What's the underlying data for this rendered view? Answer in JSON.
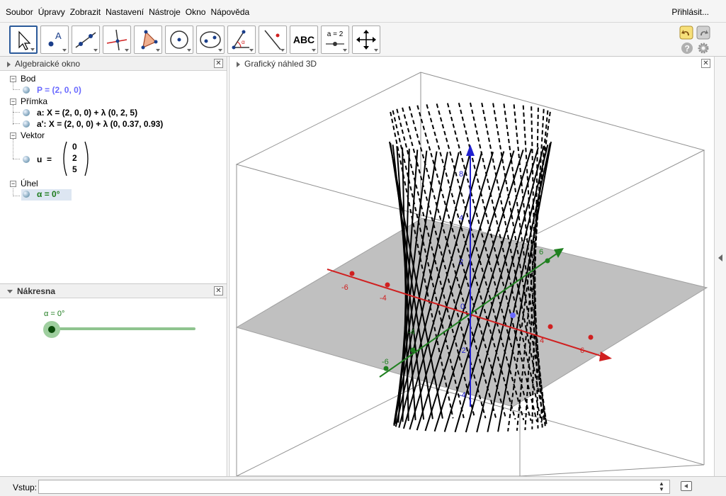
{
  "menu": {
    "items": [
      "Soubor",
      "Úpravy",
      "Zobrazit",
      "Nastavení",
      "Nástroje",
      "Okno",
      "Nápověda"
    ],
    "login": "Přihlásit..."
  },
  "toolbar": {
    "tools": [
      "move-tool",
      "point-tool",
      "line-tool",
      "perpendicular-tool",
      "polygon-tool",
      "circle-tool",
      "ellipse-tool",
      "angle-tool",
      "reflect-tool",
      "text-tool",
      "slider-tool",
      "move-view-tool"
    ],
    "text_tool_label": "ABC",
    "slider_tool_label": "a = 2"
  },
  "algebra": {
    "title": "Algebraické okno",
    "categories": [
      {
        "name": "Bod",
        "items": [
          "P = (2, 0, 0)"
        ]
      },
      {
        "name": "Přímka",
        "items": [
          "a: X = (2, 0, 0) + λ (0, 2, 5)",
          "a': X = (2, 0, 0) + λ (0, 0.37, 0.93)"
        ]
      },
      {
        "name": "Vektor",
        "vector_name": "u",
        "vector_eq": "=",
        "vector_values": [
          "0",
          "2",
          "5"
        ]
      },
      {
        "name": "Úhel",
        "items": [
          "α = 0°"
        ]
      }
    ]
  },
  "drawing": {
    "title": "Nákresna",
    "slider_label": "α = 0°",
    "slider_value": 0
  },
  "graphics3d": {
    "title": "Grafický náhled 3D",
    "x_ticks": [
      "-6",
      "-4",
      "4",
      "6"
    ],
    "y_ticks": [
      "-6",
      "-4",
      "6"
    ],
    "z_ticks": [
      "8",
      "4",
      "2",
      "0",
      "-2",
      "-4"
    ],
    "x_axis_color": "#d02020",
    "y_axis_color": "#208020",
    "z_axis_color": "#2020d0"
  },
  "input": {
    "label": "Vstup:",
    "value": ""
  },
  "colors": {
    "point": "#6a6aff",
    "angle": "#1a7a1a",
    "slider": "#7fbf7f"
  }
}
